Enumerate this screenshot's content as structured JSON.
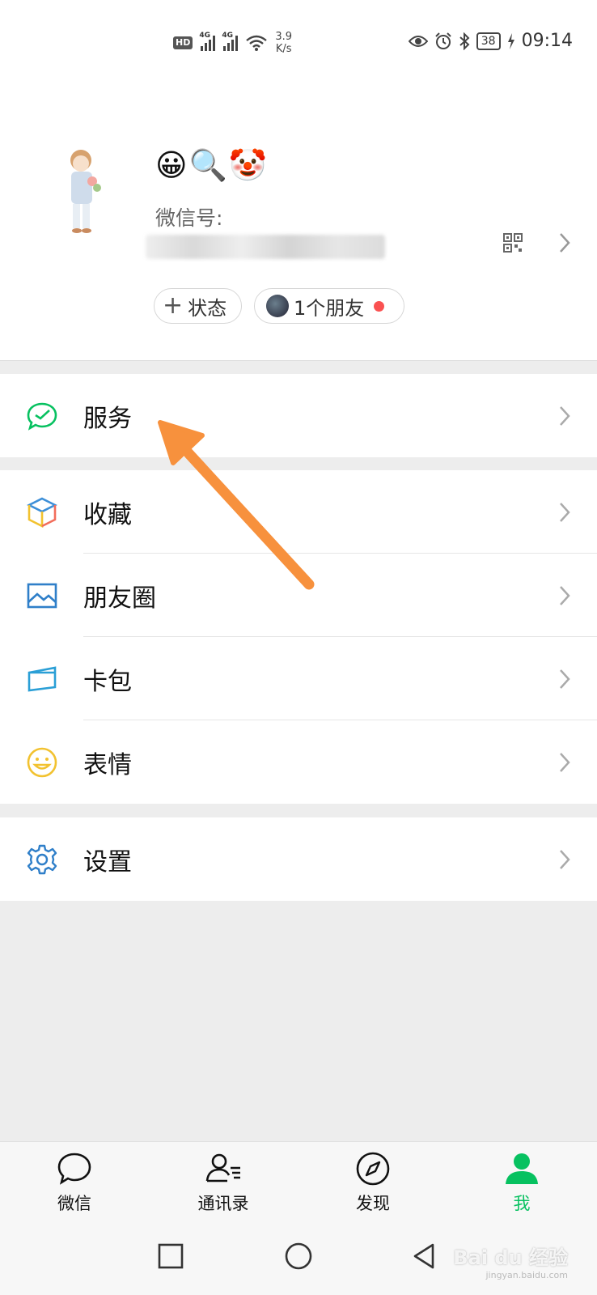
{
  "status_bar": {
    "hd": "HD",
    "net1": "4G",
    "net2": "4G",
    "speed_value": "3.9",
    "speed_unit": "K/s",
    "battery": "38",
    "time": "09:14"
  },
  "profile": {
    "nickname": "😀🔍🤡",
    "wechat_id_label": "微信号:",
    "status_button": "状态",
    "friends_button": "1个朋友"
  },
  "menu": {
    "services": "服务",
    "favorites": "收藏",
    "moments": "朋友圈",
    "cards": "卡包",
    "stickers": "表情",
    "settings": "设置"
  },
  "tabs": [
    {
      "label": "微信",
      "icon": "chat-bubble-icon"
    },
    {
      "label": "通讯录",
      "icon": "contacts-icon"
    },
    {
      "label": "发现",
      "icon": "compass-icon"
    },
    {
      "label": "我",
      "icon": "person-icon",
      "active": true
    }
  ],
  "watermark": {
    "brand": "Bai du 经验",
    "url": "jingyan.baidu.com"
  },
  "colors": {
    "accent": "#07c160",
    "annotation_arrow": "#f7913d",
    "unread_dot": "#fa5151"
  }
}
